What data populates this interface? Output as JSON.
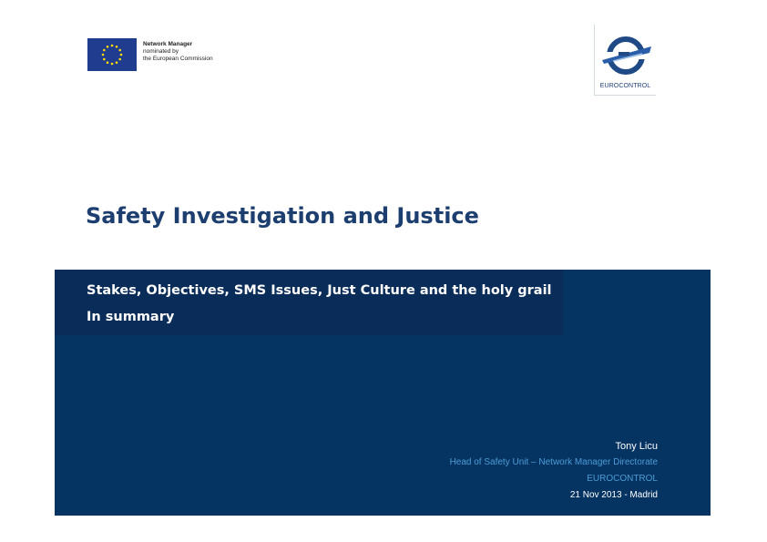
{
  "header": {
    "eu_logo": {
      "icon": "eu-flag-icon",
      "line1": "Network Manager",
      "line2": "nominated by",
      "line3": "the European Commission"
    },
    "eurocontrol_logo": {
      "icon": "eurocontrol-logo-icon",
      "wordmark": "EUROCONTROL"
    }
  },
  "title": "Safety Investigation and Justice",
  "subtitle": {
    "line1": "Stakes, Objectives, SMS Issues, Just Culture and the holy grail",
    "line2": "In summary"
  },
  "author": {
    "name": "Tony Licu",
    "role": "Head of Safety Unit – Network Manager Directorate",
    "organization": "EUROCONTROL",
    "date_location": "21 Nov 2013 - Madrid"
  },
  "colors": {
    "title": "#1d3f70",
    "banner": "#063462",
    "subtitle_box": "#0a2c59",
    "accent_text": "#4a9cd6"
  }
}
